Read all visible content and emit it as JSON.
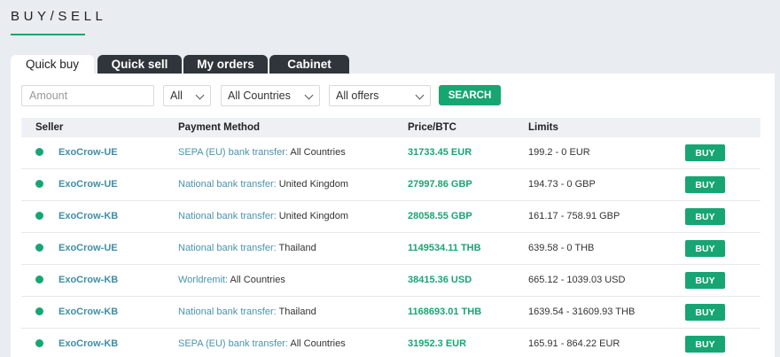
{
  "page": {
    "title": "BUY/SELL"
  },
  "tabs": [
    {
      "label": "Quick buy",
      "active": true
    },
    {
      "label": "Quick sell",
      "active": false
    },
    {
      "label": "My orders",
      "active": false
    },
    {
      "label": "Cabinet",
      "active": false
    }
  ],
  "filters": {
    "amount_placeholder": "Amount",
    "currency": "All",
    "country": "All Countries",
    "offers": "All offers",
    "search_label": "SEARCH"
  },
  "table": {
    "headers": {
      "seller": "Seller",
      "method": "Payment Method",
      "price": "Price/BTC",
      "limits": "Limits"
    },
    "buy_label": "BUY",
    "rows": [
      {
        "seller": "ExoCrow-UE",
        "method": "SEPA (EU) bank transfer:",
        "country": " All Countries",
        "price": "31733.45 EUR",
        "limits": "199.2 - 0 EUR"
      },
      {
        "seller": "ExoCrow-UE",
        "method": "National bank transfer:",
        "country": " United Kingdom",
        "price": "27997.86 GBP",
        "limits": "194.73 - 0 GBP"
      },
      {
        "seller": "ExoCrow-KB",
        "method": "National bank transfer:",
        "country": " United Kingdom",
        "price": "28058.55 GBP",
        "limits": "161.17 - 758.91 GBP"
      },
      {
        "seller": "ExoCrow-UE",
        "method": "National bank transfer:",
        "country": " Thailand",
        "price": "1149534.11 THB",
        "limits": "639.58 - 0 THB"
      },
      {
        "seller": "ExoCrow-KB",
        "method": "Worldremit:",
        "country": " All Countries",
        "price": "38415.36 USD",
        "limits": "665.12 - 1039.03 USD"
      },
      {
        "seller": "ExoCrow-KB",
        "method": "National bank transfer:",
        "country": " Thailand",
        "price": "1168693.01 THB",
        "limits": "1639.54 - 31609.93 THB"
      },
      {
        "seller": "ExoCrow-KB",
        "method": "SEPA (EU) bank transfer:",
        "country": " All Countries",
        "price": "31952.3 EUR",
        "limits": "165.91 - 864.22 EUR"
      }
    ]
  },
  "colors": {
    "accent": "#17a672",
    "link": "#4a93ac",
    "tab_dark": "#2f353b",
    "background": "#e9ecf0"
  }
}
